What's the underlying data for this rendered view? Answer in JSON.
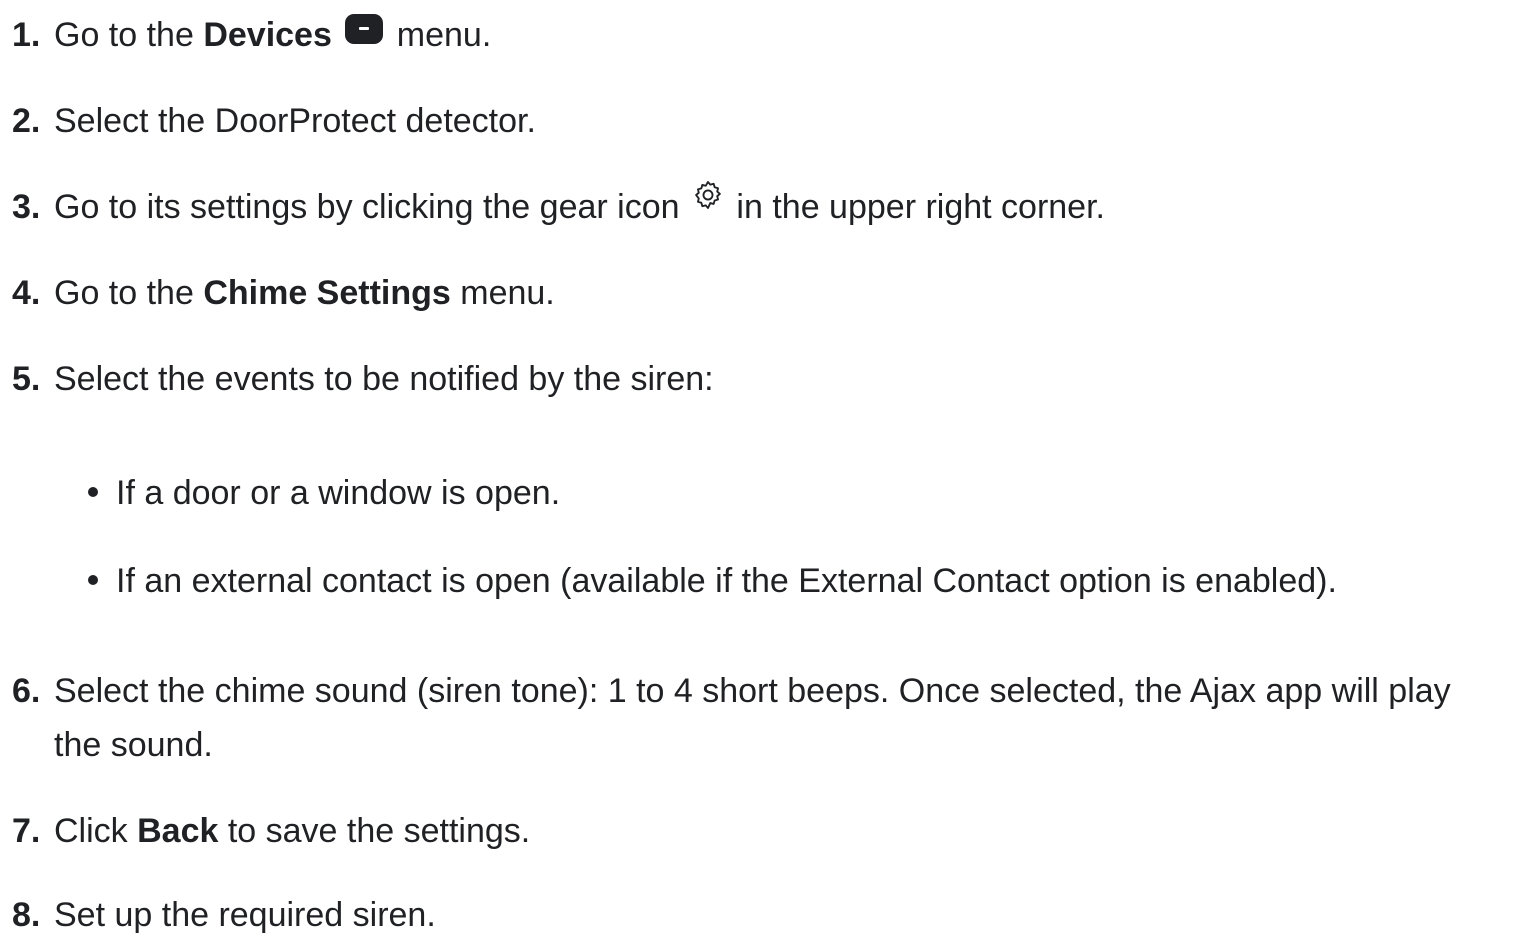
{
  "steps": [
    {
      "num": "1.",
      "pre": "Go to the ",
      "bold": "Devices",
      "post": " menu.",
      "icon": "devices-icon"
    },
    {
      "num": "2.",
      "text": "Select the DoorProtect detector."
    },
    {
      "num": "3.",
      "pre": "Go to its settings by clicking the gear icon ",
      "post": " in the upper right corner.",
      "icon": "gear-icon"
    },
    {
      "num": "4.",
      "pre": "Go to the ",
      "bold": "Chime Settings",
      "post": " menu."
    },
    {
      "num": "5.",
      "text": "Select the events to be notified by the siren:"
    },
    {
      "num": "6.",
      "text": "Select the chime sound (siren tone): 1 to 4 short beeps. Once selected, the Ajax app will play",
      "text2": "the sound."
    },
    {
      "num": "7.",
      "pre": "Click ",
      "bold": "Back",
      "post": " to save the settings."
    },
    {
      "num": "8.",
      "text": "Set up the required siren."
    }
  ],
  "bullets": [
    "If a door or a window is open.",
    "If an external contact is open (available if the External Contact option is enabled)."
  ]
}
